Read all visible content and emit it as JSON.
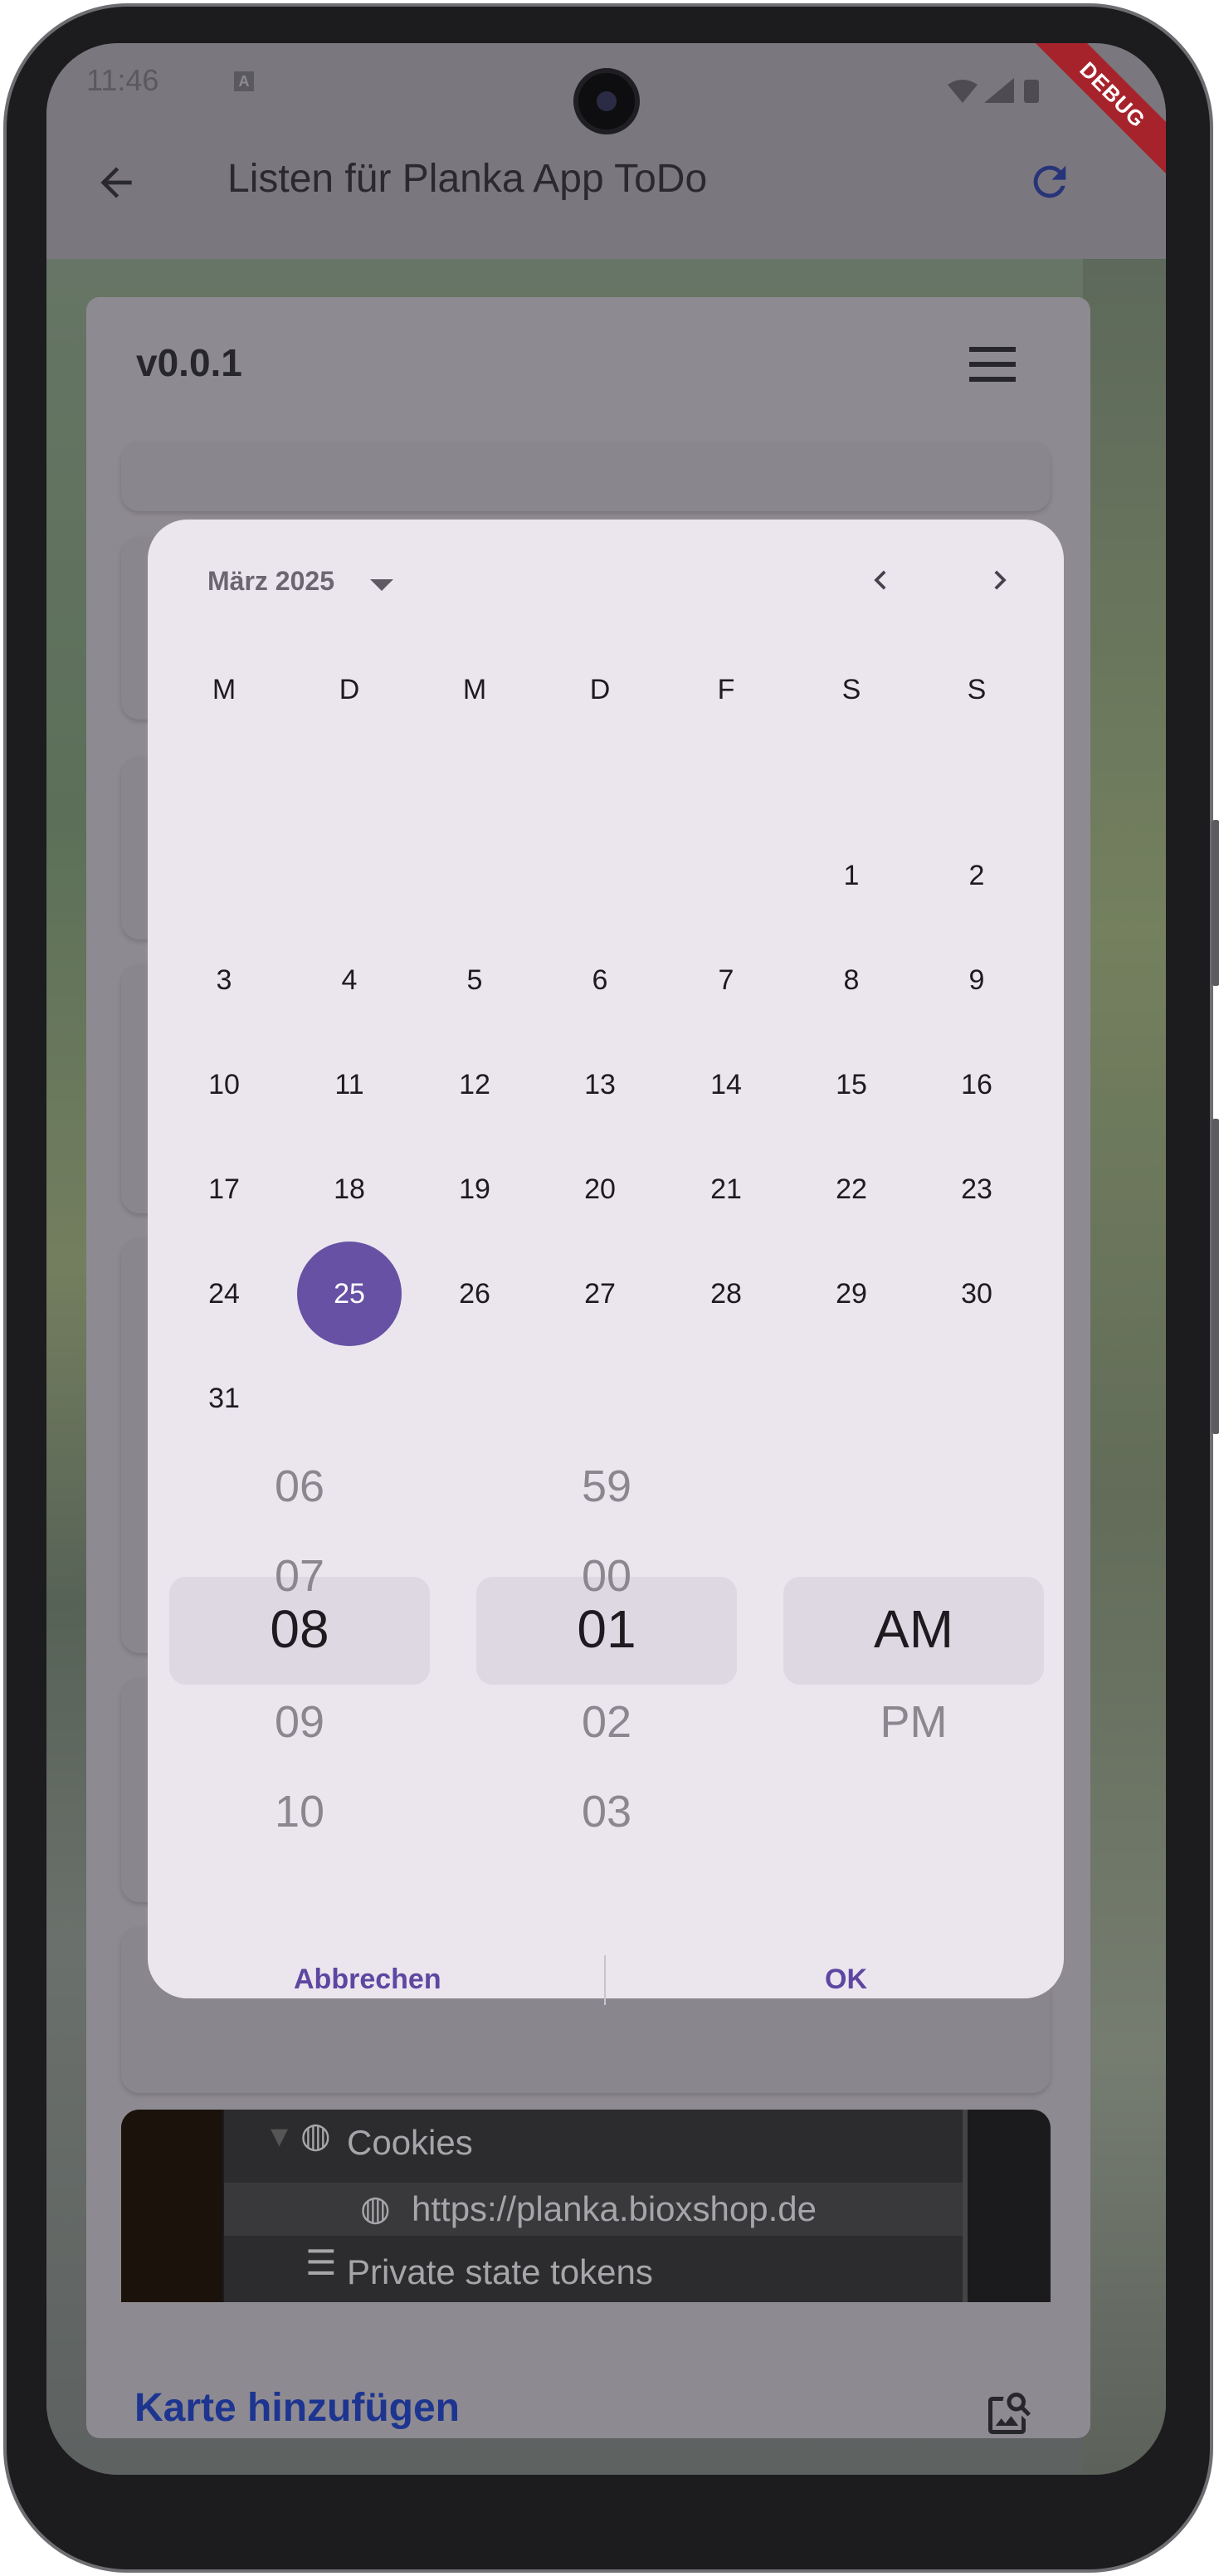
{
  "status_bar": {
    "time": "11:46",
    "notification_icon": "A",
    "debug_banner": "DEBUG"
  },
  "app_bar": {
    "title": "Listen für Planka App ToDo",
    "back_icon": "arrow-back-icon",
    "refresh_icon": "refresh-icon"
  },
  "board": {
    "version": "v0.0.1",
    "menu_icon": "hamburger-icon",
    "add_card_label": "Karte hinzufügen",
    "scan_icon": "image-search-icon"
  },
  "image_card": {
    "lines": [
      "Cookies",
      "https://planka.bioxshop.de",
      "Private state tokens"
    ]
  },
  "date_picker": {
    "month_label": "März 2025",
    "weekdays": [
      "M",
      "D",
      "M",
      "D",
      "F",
      "S",
      "S"
    ],
    "days": [
      "1",
      "2",
      "3",
      "4",
      "5",
      "6",
      "7",
      "8",
      "9",
      "10",
      "11",
      "12",
      "13",
      "14",
      "15",
      "16",
      "17",
      "18",
      "19",
      "20",
      "21",
      "22",
      "23",
      "24",
      "25",
      "26",
      "27",
      "28",
      "29",
      "30",
      "31"
    ],
    "selected_day": "25",
    "accent_color": "#6651a4"
  },
  "time_picker": {
    "hours": [
      "06",
      "07",
      "08",
      "09",
      "10"
    ],
    "minutes": [
      "59",
      "00",
      "01",
      "02",
      "03"
    ],
    "periods": [
      "AM",
      "PM"
    ],
    "selected_hour": "08",
    "selected_minute": "01",
    "selected_period": "AM"
  },
  "actions": {
    "cancel": "Abbrechen",
    "ok": "OK"
  }
}
